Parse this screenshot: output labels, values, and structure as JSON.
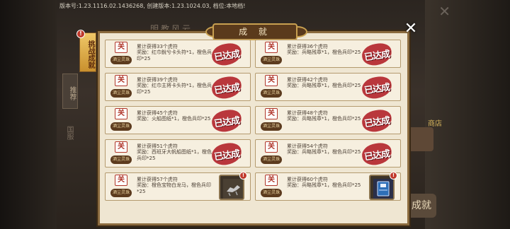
{
  "top_bar": {
    "version_text": "版本号:1.23.1116.02.1436268, 创建版本:1.23.1024.03, 档位:本地档!"
  },
  "background": {
    "title": "明教风云",
    "side_tab": "推荐",
    "side_label": "国服",
    "right_label": "商店",
    "achievement_button": "成就"
  },
  "panel": {
    "title": "成 就",
    "tab_label": "挑战成就",
    "tab_badge": "!",
    "colors": {
      "stamp": "#b3222a",
      "frame": "#8b6b3f",
      "card_bg": "#f6efdf"
    }
  },
  "medal_ribbon": "酒尘灵珠",
  "medal_char": "关",
  "achievements": [
    {
      "title": "累计获得33个虎符",
      "reward": "奖励：红巾銳兮卡头符*1，橙色兵印*25",
      "status": "已达成"
    },
    {
      "title": "累计获得36个虎符",
      "reward": "奖励：兵略残章*1，橙色兵印*25",
      "status": "已达成"
    },
    {
      "title": "累计获得39个虎符",
      "reward": "奖励：红巾主将卡头符*1，橙色兵印*25",
      "status": "已达成"
    },
    {
      "title": "累计获得42个虎符",
      "reward": "奖励：兵略残章*1，橙色兵印*25",
      "status": "已达成"
    },
    {
      "title": "累计获得45个虎符",
      "reward": "奖励：火船图纸*1，橙色兵印*25",
      "status": "已达成"
    },
    {
      "title": "累计获得48个虎符",
      "reward": "奖励：兵略残章*1，橙色兵印*25",
      "status": "已达成"
    },
    {
      "title": "累计获得51个虎符",
      "reward": "奖励：西班牙大帆船图纸*1，橙色兵印*25",
      "status": "已达成"
    },
    {
      "title": "累计获得54个虎符",
      "reward": "奖励：兵略残章*1，橙色兵印*25",
      "status": "已达成"
    },
    {
      "title": "累计获得57个虎符",
      "reward": "奖励：橙色宝物白龙马，橙色兵印*25",
      "status": "claimable",
      "item_icon": "horse-treasure-icon",
      "badge": "!"
    },
    {
      "title": "累计获得60个虎符",
      "reward": "奖励：兵略残章*1，橙色兵印*25",
      "status": "claimable",
      "item_icon": "strategy-book-icon",
      "badge": "!"
    }
  ]
}
